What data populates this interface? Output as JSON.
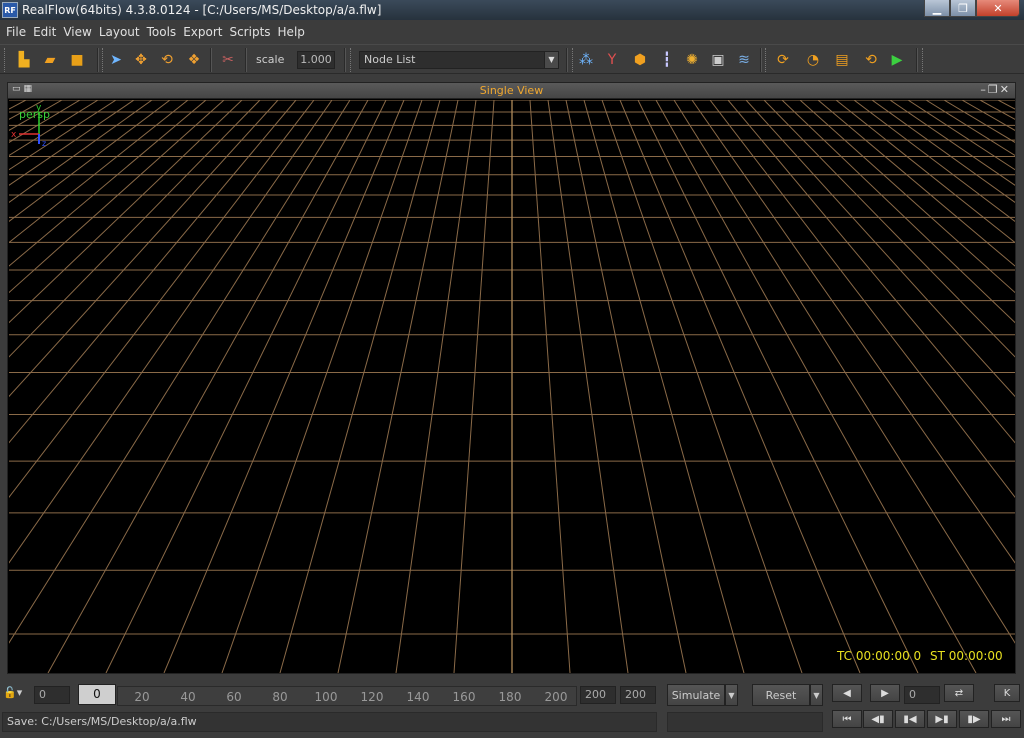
{
  "window": {
    "logo_text": "RF",
    "title": "RealFlow(64bits) 4.3.8.0124 - [C:/Users/MS/Desktop/a/a.flw]"
  },
  "menu": [
    "File",
    "Edit",
    "View",
    "Layout",
    "Tools",
    "Export",
    "Scripts",
    "Help"
  ],
  "toolbar": {
    "scale_label": "scale",
    "scale_value": "1.000",
    "node_list_value": "Node List"
  },
  "view": {
    "title": "Single View",
    "camera_label": "persp",
    "tc": "TC 00:00:00 0",
    "st": "ST 00:00:00",
    "grid_color": "#8a6a48",
    "axis": {
      "x": "x",
      "y": "y",
      "z": "z"
    }
  },
  "timeline": {
    "start": "0",
    "current": "0",
    "ticks": [
      "20",
      "40",
      "60",
      "80",
      "100",
      "120",
      "140",
      "160",
      "180",
      "200"
    ],
    "end": "200",
    "end2": "200",
    "simulate_label": "Simulate",
    "reset_label": "Reset",
    "frame": "0",
    "key_label": "K"
  },
  "status": {
    "message": "Save: C:/Users/MS/Desktop/a/a.flw"
  }
}
